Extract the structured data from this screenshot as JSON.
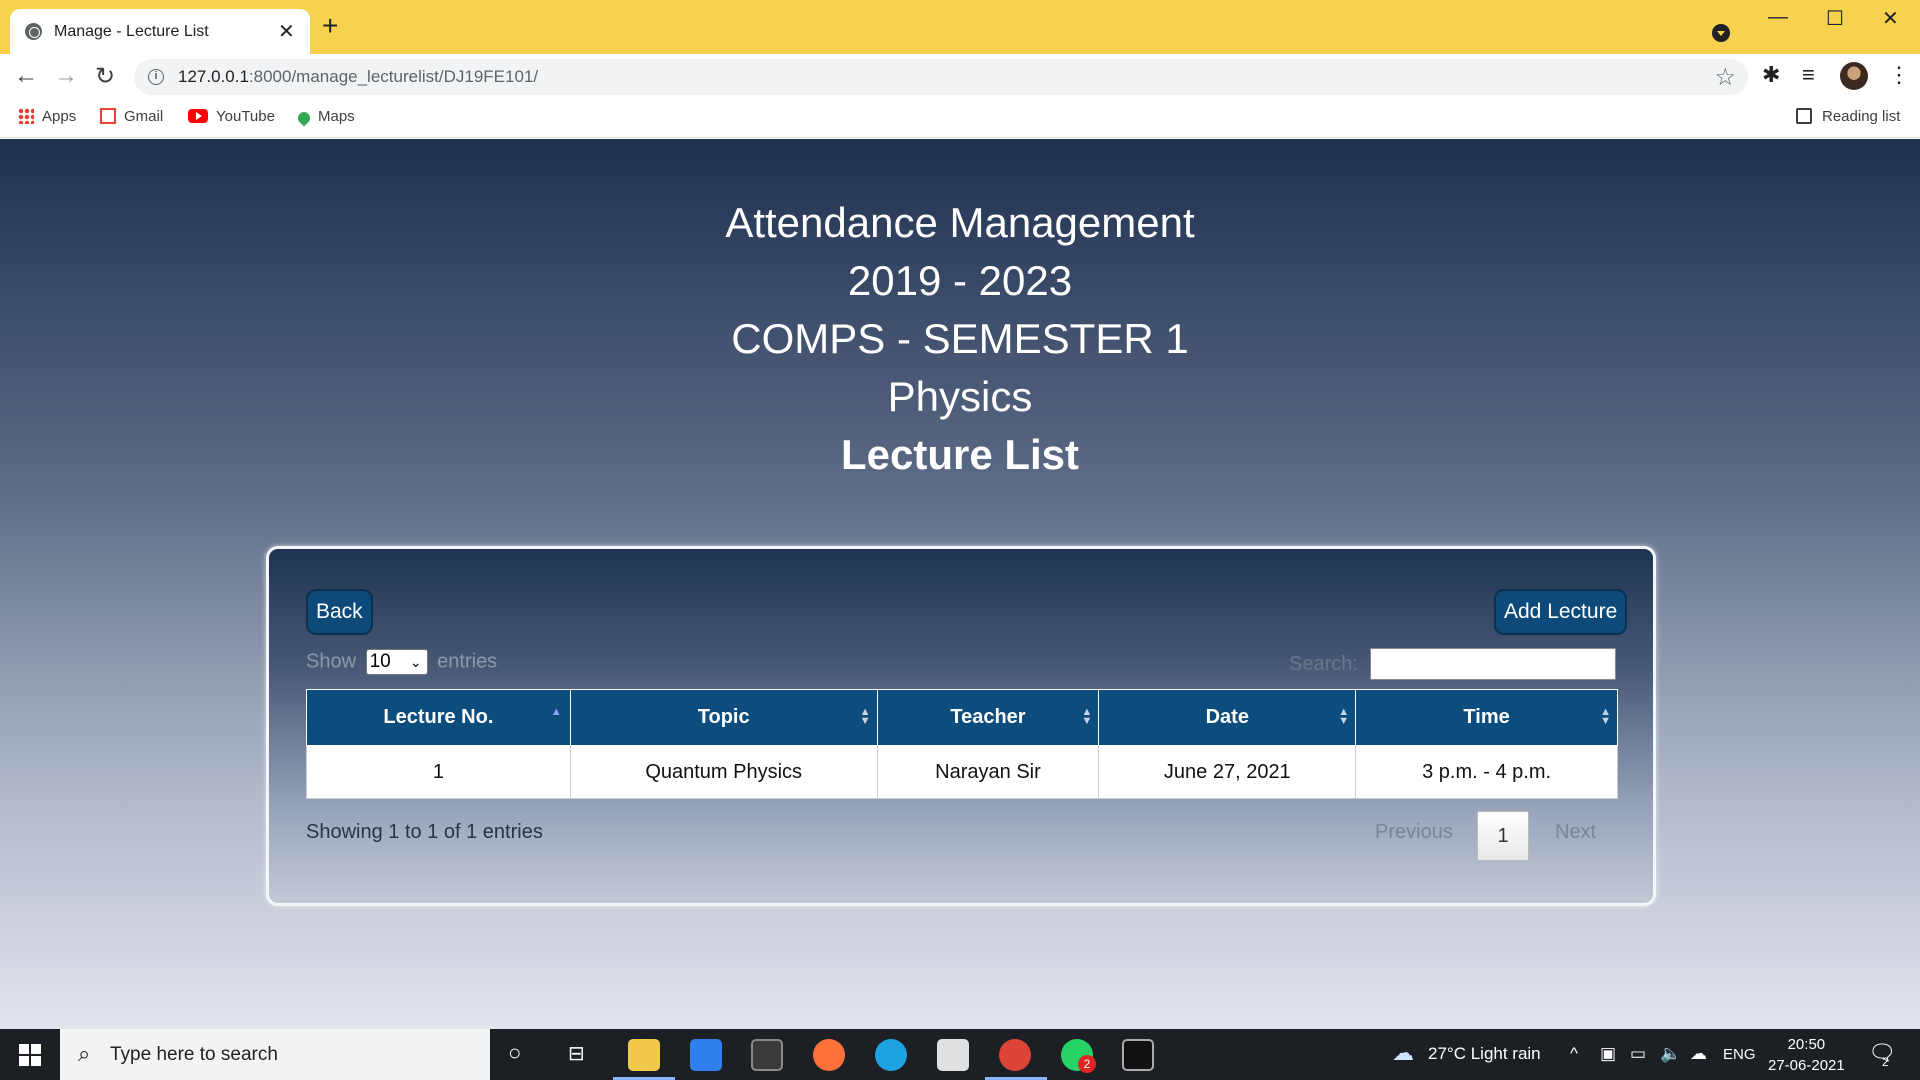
{
  "browser": {
    "tab_title": "Manage - Lecture List",
    "url_host": "127.0.0.1",
    "url_rest": ":8000/manage_lecturelist/DJ19FE101/",
    "bookmarks": [
      "Apps",
      "Gmail",
      "YouTube",
      "Maps"
    ],
    "reading_list": "Reading list"
  },
  "header": {
    "line1": "Attendance Management",
    "line2": "2019 - 2023",
    "line3": "COMPS - SEMESTER 1",
    "line4": "Physics",
    "line5": "Lecture List"
  },
  "card": {
    "back_label": "Back",
    "add_label": "Add Lecture",
    "show_label": "Show",
    "entries_label": "entries",
    "page_length": "10",
    "search_label": "Search:",
    "search_value": "",
    "columns": [
      "Lecture No.",
      "Topic",
      "Teacher",
      "Date",
      "Time"
    ],
    "rows": [
      [
        "1",
        "Quantum Physics",
        "Narayan Sir",
        "June 27, 2021",
        "3 p.m. - 4 p.m."
      ]
    ],
    "info": "Showing 1 to 1 of 1 entries",
    "previous": "Previous",
    "page": "1",
    "next": "Next"
  },
  "taskbar": {
    "search_placeholder": "Type here to search",
    "weather": "27°C  Light rain",
    "lang": "ENG",
    "time": "20:50",
    "date": "27-06-2021",
    "notification_count": "2",
    "whatsapp_badge": "2"
  },
  "colors": {
    "tabbar": "#f6d24e",
    "table_header": "#0d4d7d",
    "button": "#0d4a7a"
  }
}
